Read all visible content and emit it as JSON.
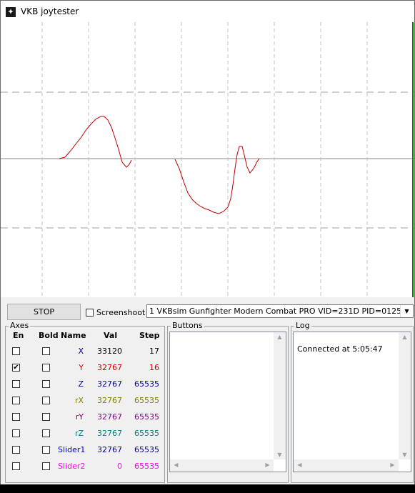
{
  "window": {
    "title": "VKB joytester",
    "app_icon": "vkb-logo-icon"
  },
  "controls": {
    "stop_label": "STOP",
    "screenshoot_label": "Screenshoot",
    "screenshoot_checked": false,
    "device_selected": "1 VKBsim Gunfighter Modern Combat PRO  VID=231D PID=0125"
  },
  "axes": {
    "group_label": "Axes",
    "headers": {
      "en": "En",
      "bold": "Bold",
      "name": "Name",
      "val": "Val",
      "step": "Step"
    },
    "rows": [
      {
        "name": "X",
        "val": "33120",
        "step": "17",
        "en": false,
        "bold": false,
        "color": "#000080",
        "valcolor": "#000000"
      },
      {
        "name": "Y",
        "val": "32767",
        "step": "16",
        "en": true,
        "bold": false,
        "color": "#e00000",
        "valcolor": "#c00000"
      },
      {
        "name": "Z",
        "val": "32767",
        "step": "65535",
        "en": false,
        "bold": false,
        "color": "#000080",
        "valcolor": "#000080"
      },
      {
        "name": "rX",
        "val": "32767",
        "step": "65535",
        "en": false,
        "bold": false,
        "color": "#808000",
        "valcolor": "#808000"
      },
      {
        "name": "rY",
        "val": "32767",
        "step": "65535",
        "en": false,
        "bold": false,
        "color": "#800080",
        "valcolor": "#800080"
      },
      {
        "name": "rZ",
        "val": "32767",
        "step": "65535",
        "en": false,
        "bold": false,
        "color": "#008080",
        "valcolor": "#008080"
      },
      {
        "name": "Slider1",
        "val": "32767",
        "step": "65535",
        "en": false,
        "bold": false,
        "color": "#0000c0",
        "valcolor": "#000080"
      },
      {
        "name": "Slider2",
        "val": "0",
        "step": "65535",
        "en": false,
        "bold": false,
        "color": "#ff00ff",
        "valcolor": "#ff00ff"
      }
    ]
  },
  "buttons_group": {
    "label": "Buttons"
  },
  "log": {
    "label": "Log",
    "lines": [
      "Connected at 5:05:47"
    ]
  },
  "graph": {
    "trace_color": "#c00000",
    "grid_color": "#c0c0c0",
    "marker_color": "#008000"
  }
}
